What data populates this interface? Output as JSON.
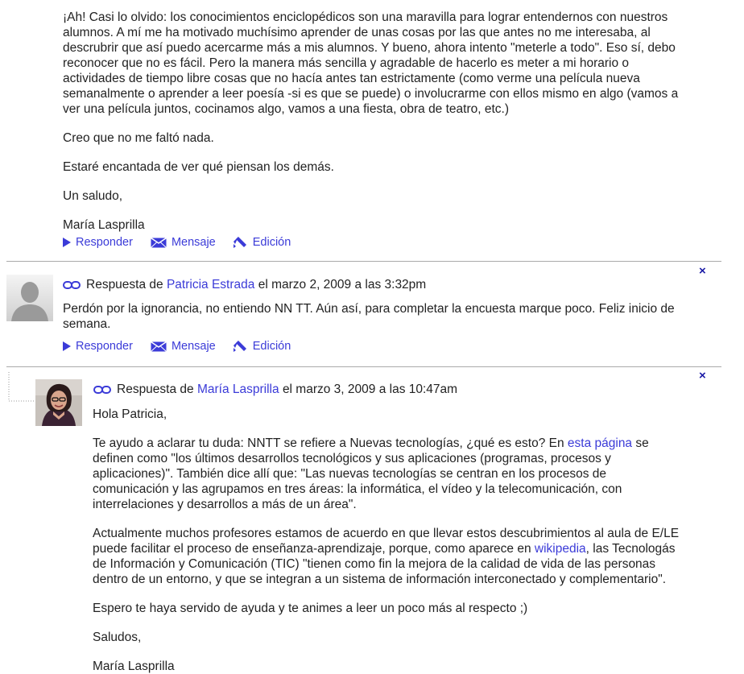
{
  "post1": {
    "paragraphs": [
      "¡Ah! Casi lo olvido: los conocimientos enciclopédicos son una maravilla para lograr entendernos con nuestros alumnos. A mí me ha motivado muchísimo aprender de unas cosas por las que antes no me interesaba, al descrubrir que así puedo acercarme más a mis alumnos. Y bueno, ahora intento \"meterle a todo\". Eso sí, debo reconocer que no es fácil. Pero la manera más sencilla y agradable de hacerlo es meter a mi horario o actividades de tiempo libre cosas que no hacía antes tan estrictamente (como verme una película nueva semanalmente o aprender a leer poesía -si es que se puede) o involucrarme con ellos mismo en algo (vamos a ver una película juntos, cocinamos algo, vamos a una fiesta, obra de teatro, etc.)",
      "Creo que no me faltó nada.",
      "Estaré encantada de ver qué piensan los demás.",
      "Un saludo,",
      "María Lasprilla"
    ],
    "actions": {
      "reply": "Responder",
      "message": "Mensaje",
      "edit": "Edición"
    }
  },
  "reply1": {
    "prefix": "Respuesta de",
    "author": "Patricia Estrada",
    "date": "el marzo 2, 2009 a las 3:32pm",
    "body": "Perdón por la ignorancia, no entiendo NN TT. Aún así, para completar la encuesta marque poco. Feliz inicio de semana.",
    "actions": {
      "reply": "Responder",
      "message": "Mensaje",
      "edit": "Edición"
    },
    "close": "×"
  },
  "reply2": {
    "prefix": "Respuesta de",
    "author": "María Lasprilla",
    "date": "el marzo 3, 2009 a las 10:47am",
    "greeting": "Hola Patricia,",
    "p1_a": "Te ayudo a aclarar tu duda: NNTT se refiere a Nuevas tecnologías, ¿qué es esto? En ",
    "p1_link": "esta página",
    "p1_b": " se definen como \"los últimos desarrollos tecnológicos y sus aplicaciones (programas, procesos y aplicaciones)\". También dice allí que: \"Las nuevas tecnologías se centran en los procesos de comunicación y las agrupamos en tres áreas: la informática, el vídeo y la telecomunicación, con interrelaciones y desarrollos a más de un área\".",
    "p2_a": "Actualmente muchos profesores estamos de acuerdo en que llevar estos descubrimientos al aula de E/LE puede facilitar el proceso de enseñanza-aprendizaje, porque, como aparece en ",
    "p2_link": "wikipedia",
    "p2_b": ", las Tecnologás de Información y Comunicación (TIC) \"tienen como fin la mejora de la calidad de vida de las personas dentro de un entorno, y que se integran a un sistema de información interconectado y complementario\".",
    "p3": "Espero te haya servido de ayuda y te animes a leer un poco más al respecto ;)",
    "p4": "Saludos,",
    "p5": "María Lasprilla",
    "close": "×"
  },
  "colors": {
    "link": "#3b3bd8",
    "close": "#1a1aa6"
  },
  "icons": [
    "reply-arrow-icon",
    "envelope-icon",
    "pencil-icon",
    "permalink-icon",
    "close-icon"
  ]
}
